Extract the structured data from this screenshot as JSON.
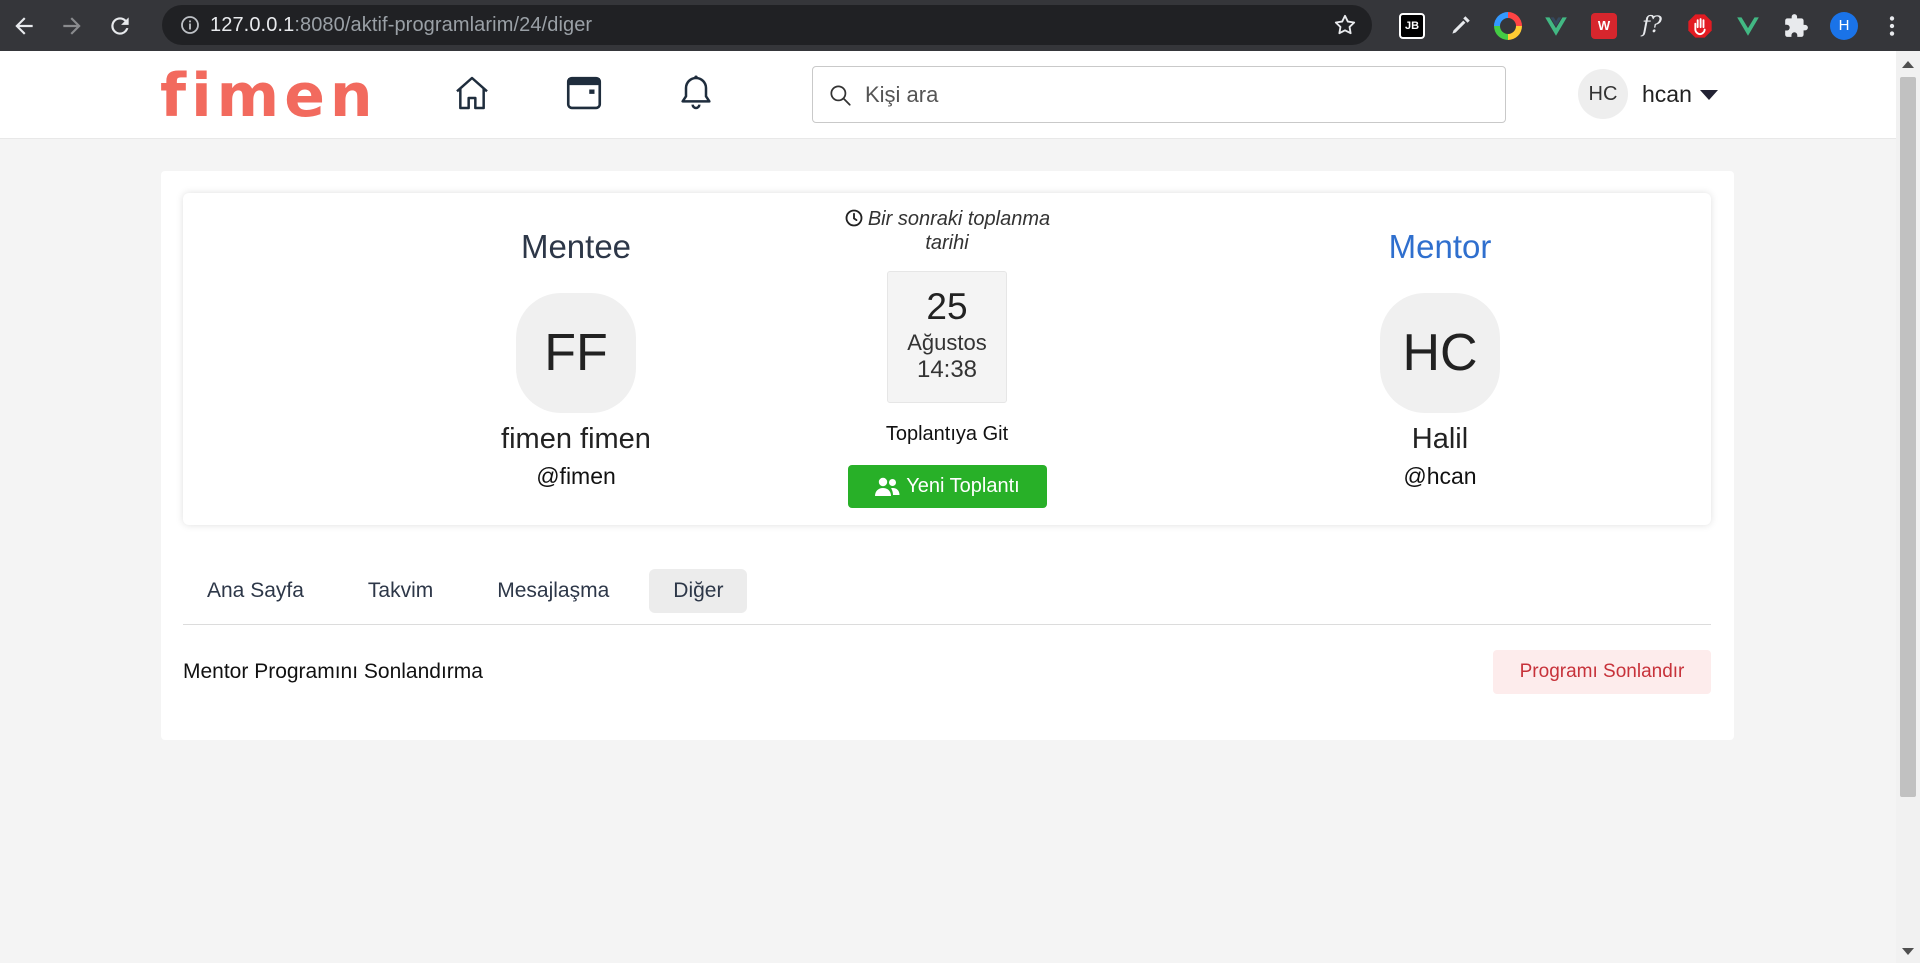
{
  "browser": {
    "url_host": "127.0.0.1",
    "url_path": ":8080/aktif-programlarim/24/diger",
    "profile_initial": "H",
    "extensions": [
      {
        "name": "jetbrains-extension-icon",
        "label": "JB",
        "color": "#111111"
      },
      {
        "name": "f-extension-icon",
        "label": "f?",
        "color": "#35363a"
      }
    ]
  },
  "navbar": {
    "logo": "fimen",
    "search_placeholder": "Kişi ara",
    "user_initials": "HC",
    "user_name": "hcan"
  },
  "program": {
    "mentee": {
      "role": "Mentee",
      "initials": "FF",
      "name": "fimen fimen",
      "handle": "@fimen"
    },
    "mentor": {
      "role": "Mentor",
      "initials": "HC",
      "name": "Halil",
      "handle": "@hcan"
    },
    "meeting": {
      "next_label": "Bir sonraki toplanma tarihi",
      "day": "25",
      "month": "Ağustos",
      "time": "14:38",
      "join_label": "Toplantıya Git",
      "new_meeting_label": "Yeni Toplantı"
    }
  },
  "tabs": [
    {
      "label": "Ana Sayfa",
      "active": false
    },
    {
      "label": "Takvim",
      "active": false
    },
    {
      "label": "Mesajlaşma",
      "active": false
    },
    {
      "label": "Diğer",
      "active": true
    }
  ],
  "end_program": {
    "label": "Mentor Programını Sonlandırma",
    "button_label": "Programı Sonlandır"
  },
  "colors": {
    "brand": "#f26a5e",
    "mentor_accent": "#2f6fce",
    "success": "#28b028",
    "danger_text": "#c7323a",
    "danger_bg": "#fdecec"
  }
}
